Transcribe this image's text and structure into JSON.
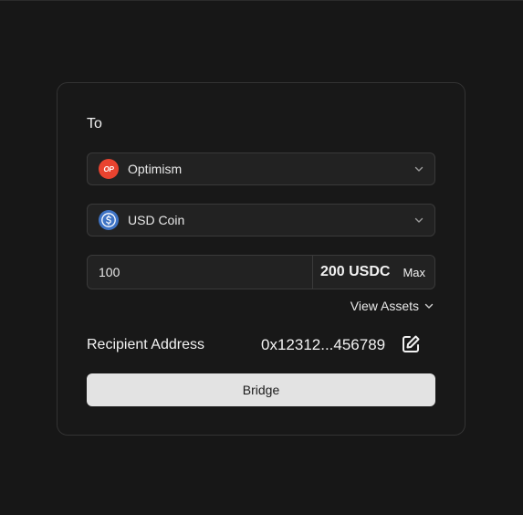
{
  "bridge_form": {
    "section_label": "To",
    "network_select": {
      "selected": "Optimism",
      "icon": "optimism-logo-icon",
      "icon_text": "OP",
      "icon_color": "#e9432f"
    },
    "token_select": {
      "selected": "USD Coin",
      "icon": "usdc-logo-icon",
      "icon_color": "#3e73c4"
    },
    "amount": {
      "value": "100",
      "balance": "200 USDC",
      "max_label": "Max"
    },
    "view_assets_label": "View Assets",
    "recipient": {
      "label": "Recipient Address",
      "address": "0x12312...456789",
      "edit_icon": "edit-icon"
    },
    "bridge_button_label": "Bridge"
  },
  "colors": {
    "background": "#171717",
    "card_border": "#333333",
    "field_background": "#222222",
    "button_background": "#e3e3e3"
  }
}
